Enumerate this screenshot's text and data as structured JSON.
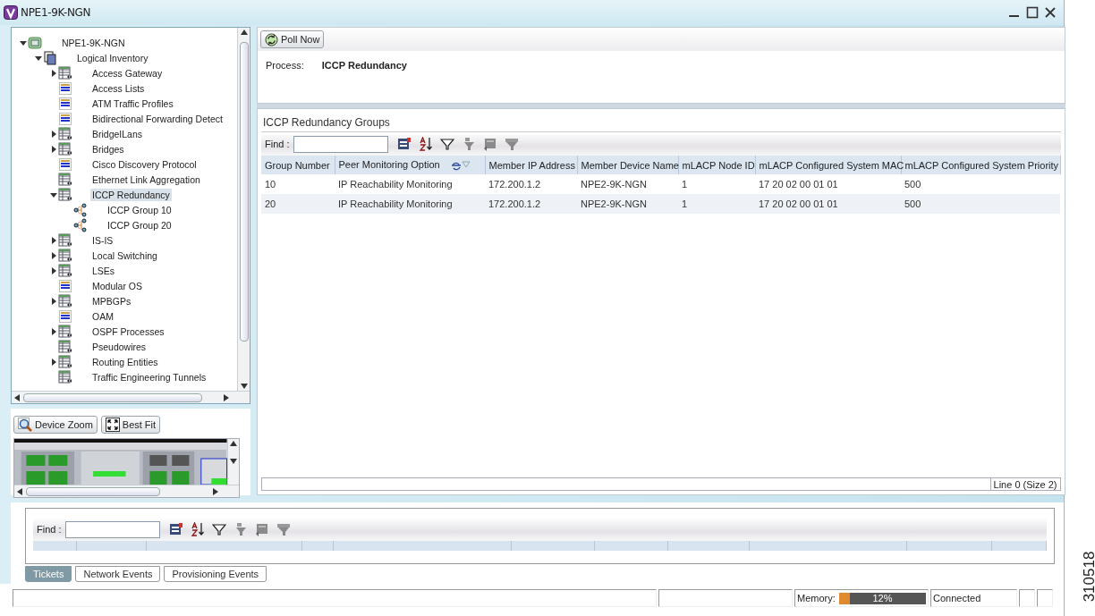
{
  "window": {
    "title": "NPE1-9K-NGN"
  },
  "tree": {
    "items": [
      {
        "label": "NPE1-9K-NGN",
        "kind": "device",
        "expanded": true,
        "selected": false,
        "children": [
          {
            "label": "Logical Inventory",
            "kind": "inventory",
            "expanded": true,
            "selected": false,
            "children": [
              {
                "label": "Access Gateway",
                "kind": "table",
                "expanded": false,
                "selected": false
              },
              {
                "label": "Access Lists",
                "kind": "list",
                "selected": false
              },
              {
                "label": "ATM Traffic Profiles",
                "kind": "list",
                "selected": false
              },
              {
                "label": "Bidirectional Forwarding Detect",
                "kind": "list",
                "selected": false
              },
              {
                "label": "BridgeILans",
                "kind": "table",
                "expanded": false,
                "selected": false
              },
              {
                "label": "Bridges",
                "kind": "table",
                "expanded": false,
                "selected": false
              },
              {
                "label": "Cisco Discovery Protocol",
                "kind": "list",
                "selected": false
              },
              {
                "label": "Ethernet Link Aggregation",
                "kind": "table",
                "selected": false
              },
              {
                "label": "ICCP Redundancy",
                "kind": "table",
                "expanded": true,
                "selected": true,
                "children": [
                  {
                    "label": "ICCP Group 10",
                    "kind": "group",
                    "selected": false
                  },
                  {
                    "label": "ICCP Group 20",
                    "kind": "group",
                    "selected": false
                  }
                ]
              },
              {
                "label": "IS-IS",
                "kind": "table",
                "expanded": false,
                "selected": false
              },
              {
                "label": "Local Switching",
                "kind": "table",
                "expanded": false,
                "selected": false
              },
              {
                "label": "LSEs",
                "kind": "table",
                "expanded": false,
                "selected": false
              },
              {
                "label": "Modular OS",
                "kind": "list",
                "selected": false
              },
              {
                "label": "MPBGPs",
                "kind": "table",
                "expanded": false,
                "selected": false
              },
              {
                "label": "OAM",
                "kind": "list",
                "selected": false
              },
              {
                "label": "OSPF Processes",
                "kind": "table",
                "expanded": false,
                "selected": false
              },
              {
                "label": "Pseudowires",
                "kind": "table",
                "selected": false
              },
              {
                "label": "Routing Entities",
                "kind": "table",
                "expanded": false,
                "selected": false
              },
              {
                "label": "Traffic Engineering Tunnels",
                "kind": "table",
                "selected": false
              }
            ]
          }
        ]
      }
    ]
  },
  "device_view": {
    "buttons": [
      "Device Zoom",
      "Best Fit"
    ]
  },
  "process": {
    "poll_button": "Poll Now",
    "label": "Process:",
    "value": "ICCP Redundancy"
  },
  "groups": {
    "title": "ICCP Redundancy Groups",
    "find_label": "Find :",
    "columns": [
      {
        "label": "Group Number",
        "sorted": false
      },
      {
        "label": "Peer Monitoring Option",
        "sorted": true
      },
      {
        "label": "Member IP Address",
        "sorted": false
      },
      {
        "label": "Member Device Name",
        "sorted": false
      },
      {
        "label": "mLACP Node ID",
        "sorted": false
      },
      {
        "label": "mLACP Configured System MAC",
        "sorted": false
      },
      {
        "label": "mLACP Configured System Priority",
        "sorted": false
      }
    ],
    "rows": [
      [
        "10",
        "IP Reachability Monitoring",
        "172.200.1.2",
        "NPE2-9K-NGN",
        "1",
        "17 20 02 00 01 01",
        "500"
      ],
      [
        "20",
        "IP Reachability Monitoring",
        "172.200.1.2",
        "NPE2-9K-NGN",
        "1",
        "17 20 02 00 01 01",
        "500"
      ]
    ],
    "footer": "Line 0 (Size 2)"
  },
  "events": {
    "find_label": "Find :",
    "tabs": [
      {
        "label": "Tickets",
        "selected": true
      },
      {
        "label": "Network Events",
        "selected": false
      },
      {
        "label": "Provisioning Events",
        "selected": false
      }
    ]
  },
  "status_bar": {
    "memory_label": "Memory:",
    "memory": {
      "level": 0.12,
      "reading": "12%"
    },
    "connection": "Connected"
  },
  "figure_number": "310518"
}
